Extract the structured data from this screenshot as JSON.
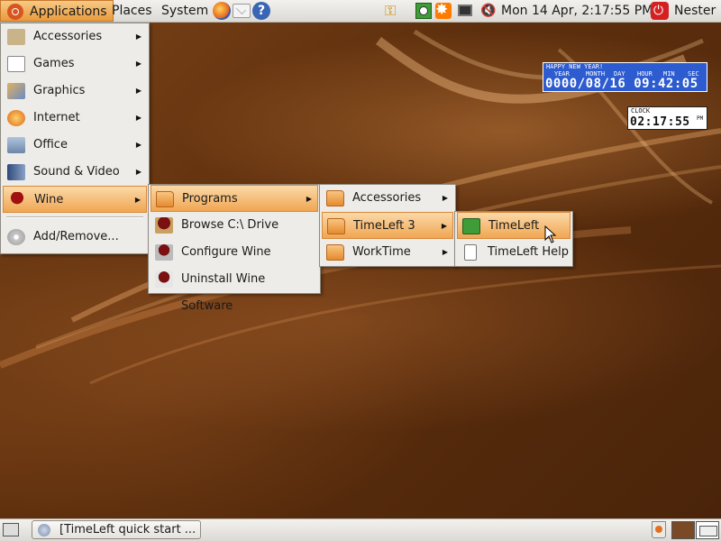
{
  "top_panel": {
    "menus": {
      "applications": "Applications",
      "places": "Places",
      "system": "System"
    },
    "launchers": [
      "firefox-icon",
      "mail-icon",
      "help-icon"
    ],
    "clock": "Mon 14 Apr,  2:17:55 PM",
    "user": "Nester"
  },
  "applications_menu": {
    "items": [
      {
        "label": "Accessories",
        "icon": "accessories-icon",
        "has_submenu": true
      },
      {
        "label": "Games",
        "icon": "games-icon",
        "has_submenu": true
      },
      {
        "label": "Graphics",
        "icon": "graphics-icon",
        "has_submenu": true
      },
      {
        "label": "Internet",
        "icon": "internet-icon",
        "has_submenu": true
      },
      {
        "label": "Office",
        "icon": "office-icon",
        "has_submenu": true
      },
      {
        "label": "Sound & Video",
        "icon": "sound-video-icon",
        "has_submenu": true
      },
      {
        "label": "Wine",
        "icon": "wine-icon",
        "has_submenu": true,
        "highlighted": true
      },
      {
        "label": "Add/Remove...",
        "icon": "add-remove-icon",
        "has_submenu": false
      }
    ]
  },
  "wine_menu": {
    "items": [
      {
        "label": "Programs",
        "icon": "folder-icon",
        "has_submenu": true,
        "highlighted": true
      },
      {
        "label": "Browse C:\\ Drive",
        "icon": "wine-browse-icon"
      },
      {
        "label": "Configure Wine",
        "icon": "wine-config-icon"
      },
      {
        "label": "Uninstall Wine Software",
        "icon": "wine-uninstall-icon"
      }
    ]
  },
  "programs_menu": {
    "items": [
      {
        "label": "Accessories",
        "icon": "folder-icon",
        "has_submenu": true
      },
      {
        "label": "TimeLeft 3",
        "icon": "folder-icon",
        "has_submenu": true,
        "highlighted": true
      },
      {
        "label": "WorkTime",
        "icon": "folder-icon",
        "has_submenu": true
      }
    ]
  },
  "timeleft3_menu": {
    "items": [
      {
        "label": "TimeLeft",
        "icon": "timeleft-icon",
        "highlighted": true
      },
      {
        "label": "TimeLeft Help",
        "icon": "help-document-icon"
      }
    ]
  },
  "widgets": {
    "new_year": {
      "title": "HAPPY NEW YEAR!",
      "headers": [
        "YEAR",
        "MONTH",
        "DAY",
        "HOUR",
        "MIN",
        "SEC"
      ],
      "values": "0000/08/16 09:42:05"
    },
    "clock": {
      "label": "CLOCK",
      "time": "02:17:55",
      "suffix": "PM"
    }
  },
  "bottom_panel": {
    "task_label": "[TimeLeft quick start ...",
    "workspaces": 2
  },
  "colors": {
    "menu_highlight": "#f0a652",
    "desktop": "#5e2f0d",
    "widget_blue": "#2d5bd0"
  }
}
